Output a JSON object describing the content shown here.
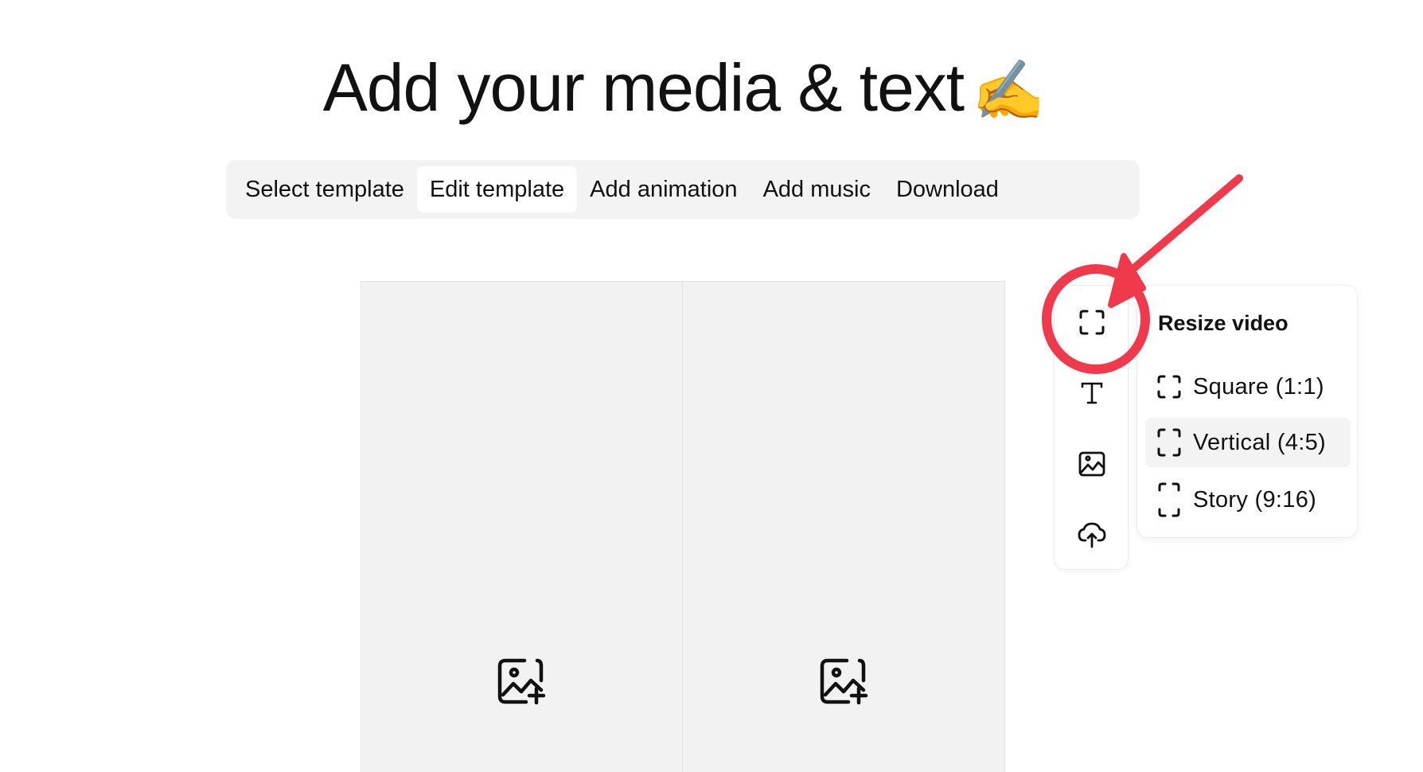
{
  "page": {
    "title": "Add your media & text",
    "title_emoji": "✍️"
  },
  "steps": [
    {
      "label": "Select template",
      "active": false
    },
    {
      "label": "Edit template",
      "active": true
    },
    {
      "label": "Add animation",
      "active": false
    },
    {
      "label": "Add music",
      "active": false
    },
    {
      "label": "Download",
      "active": false
    }
  ],
  "canvas": {
    "panels": [
      {
        "icon": "image-add-icon"
      },
      {
        "icon": "image-add-icon"
      }
    ]
  },
  "toolbar": {
    "tools": [
      {
        "name": "resize",
        "icon": "resize-frame-icon"
      },
      {
        "name": "text",
        "icon": "text-icon"
      },
      {
        "name": "image",
        "icon": "image-icon"
      },
      {
        "name": "upload",
        "icon": "cloud-upload-icon"
      }
    ]
  },
  "resize_menu": {
    "title": "Resize video",
    "options": [
      {
        "label": "Square (1:1)",
        "icon": "square-frame-icon",
        "highlighted": false
      },
      {
        "label": "Vertical (4:5)",
        "icon": "vertical-frame-icon",
        "highlighted": true
      },
      {
        "label": "Story (9:16)",
        "icon": "story-frame-icon",
        "highlighted": false
      }
    ]
  },
  "annotation": {
    "color": "#f0394a",
    "shapes": [
      "circle",
      "arrow"
    ]
  },
  "colors": {
    "background": "#ffffff",
    "stepbar_bg": "#f3f3f3",
    "canvas_bg": "#f2f2f2",
    "annotation_red": "#f0394a"
  }
}
